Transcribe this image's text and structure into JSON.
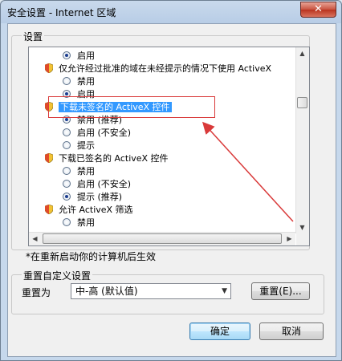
{
  "window": {
    "title": "安全设置 - Internet 区域",
    "close_label": "✕"
  },
  "settings": {
    "group_label": "设置",
    "rows": [
      {
        "kind": "opt",
        "label": "启用",
        "checked": true
      },
      {
        "kind": "head",
        "label": "仅允许经过批准的域在未经提示的情况下使用 ActiveX"
      },
      {
        "kind": "opt",
        "label": "禁用",
        "checked": false
      },
      {
        "kind": "opt",
        "label": "启用",
        "checked": true
      },
      {
        "kind": "head",
        "label": "下载未签名的 ActiveX 控件",
        "selected": true
      },
      {
        "kind": "opt",
        "label": "禁用 (推荐)",
        "checked": true
      },
      {
        "kind": "opt",
        "label": "启用 (不安全)",
        "checked": false
      },
      {
        "kind": "opt",
        "label": "提示",
        "checked": false
      },
      {
        "kind": "head",
        "label": "下载已签名的 ActiveX 控件"
      },
      {
        "kind": "opt",
        "label": "禁用",
        "checked": false
      },
      {
        "kind": "opt",
        "label": "启用 (不安全)",
        "checked": false
      },
      {
        "kind": "opt",
        "label": "提示 (推荐)",
        "checked": true
      },
      {
        "kind": "head",
        "label": "允许 ActiveX 筛选"
      },
      {
        "kind": "opt",
        "label": "禁用",
        "checked": false
      }
    ],
    "note": "*在重新启动你的计算机后生效"
  },
  "reset": {
    "group_label": "重置自定义设置",
    "reset_to_label": "重置为",
    "selected_value": "中-高 (默认值)",
    "reset_button": "重置(E)...",
    "ok_button": "确定",
    "cancel_button": "取消"
  },
  "colors": {
    "selection": "#3399ff",
    "annotation": "#d93a3a"
  }
}
